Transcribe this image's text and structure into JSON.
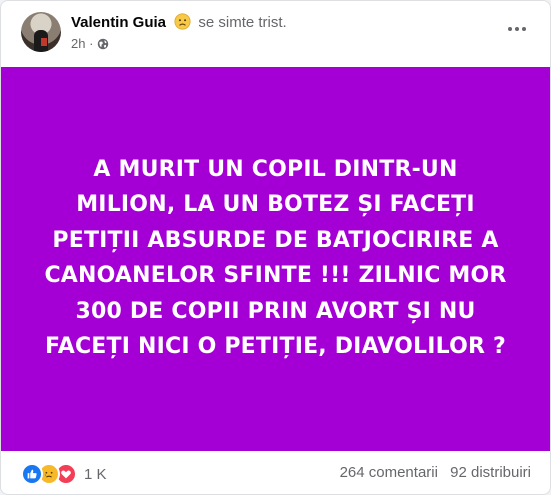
{
  "author": {
    "name": "Valentin Guia",
    "feeling": "se simte trist."
  },
  "meta": {
    "time": "2h ·",
    "privacy_icon": "globe-icon"
  },
  "post": {
    "background_color": "#a400d6",
    "text": "A MURIT UN COPIL DINTR-UN MILION, LA UN BOTEZ ȘI FACEȚI PETIȚII ABSURDE DE BATJOCIRIRE A CANOANELOR SFINTE !!! ZILNIC MOR 300 DE COPII PRIN AVORT ȘI NU FACEȚI NICI O PETIȚIE, DIAVOLILOR ?"
  },
  "footer": {
    "reactions": [
      "like-icon",
      "sad-icon",
      "love-icon"
    ],
    "reaction_count": "1 K",
    "comments": "264 comentarii",
    "shares": "92 distribuiri"
  }
}
